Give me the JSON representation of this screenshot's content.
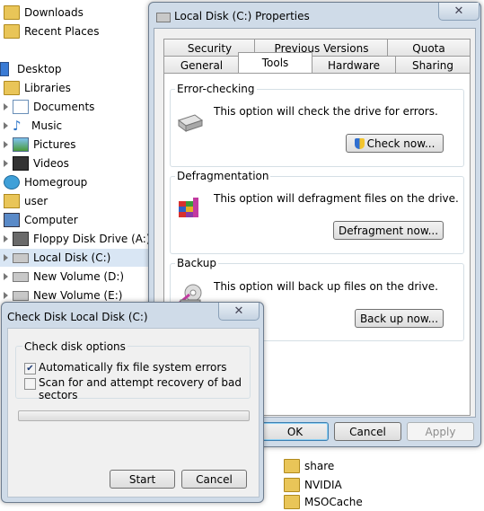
{
  "nav": {
    "items": [
      {
        "label": "Downloads"
      },
      {
        "label": "Recent Places"
      },
      {
        "label": "Desktop"
      },
      {
        "label": "Libraries"
      },
      {
        "label": "Documents"
      },
      {
        "label": "Music"
      },
      {
        "label": "Pictures"
      },
      {
        "label": "Videos"
      },
      {
        "label": "Homegroup"
      },
      {
        "label": "user"
      },
      {
        "label": "Computer"
      },
      {
        "label": "Floppy Disk Drive (A:)"
      },
      {
        "label": "Local Disk (C:)"
      },
      {
        "label": "New Volume (D:)"
      },
      {
        "label": "New Volume (E:)"
      }
    ]
  },
  "content_items": [
    "share",
    "NVIDIA",
    "MSOCache"
  ],
  "properties": {
    "title": "Local Disk (C:) Properties",
    "close_glyph": "✕",
    "tabs_top": [
      "Security",
      "Previous Versions",
      "Quota"
    ],
    "tabs_bottom": [
      "General",
      "Tools",
      "Hardware",
      "Sharing"
    ],
    "active_tab": "Tools",
    "sections": {
      "error_checking": {
        "title": "Error-checking",
        "desc": "This option will check the drive for errors.",
        "button": "Check now..."
      },
      "defrag": {
        "title": "Defragmentation",
        "desc": "This option will defragment files on the drive.",
        "button": "Defragment now..."
      },
      "backup": {
        "title": "Backup",
        "desc": "This option will back up files on the drive.",
        "button": "Back up now..."
      }
    },
    "ok": "OK",
    "cancel": "Cancel",
    "apply": "Apply"
  },
  "checkdisk": {
    "title": "Check Disk Local Disk (C:)",
    "close_glyph": "✕",
    "group_title": "Check disk options",
    "option1": {
      "label": "Automatically fix file system errors",
      "checked": true
    },
    "option2": {
      "label": "Scan for and attempt recovery of bad sectors",
      "checked": false
    },
    "progress": 0,
    "start": "Start",
    "cancel": "Cancel"
  }
}
